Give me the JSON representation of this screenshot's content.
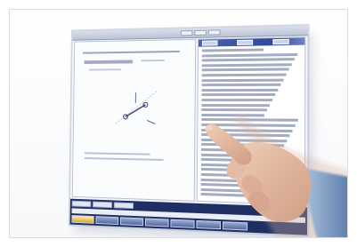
{
  "scene": {
    "subject": "touch-panel",
    "colors": {
      "frame_border": "#dcdcdc",
      "screen_bg": "#f4f6fa",
      "header_blue": "#2e4a9a",
      "bottom_bar": "#1f2f63",
      "skin": "#e2b8a0",
      "sleeve": "#7f9cc2"
    }
  },
  "screen": {
    "left_pane": {
      "title": "",
      "formula": "",
      "notes": []
    },
    "right_pane": {
      "tabs": [
        "",
        "",
        ""
      ]
    },
    "softkeys": [
      "",
      "",
      "",
      "",
      "",
      "",
      ""
    ]
  }
}
